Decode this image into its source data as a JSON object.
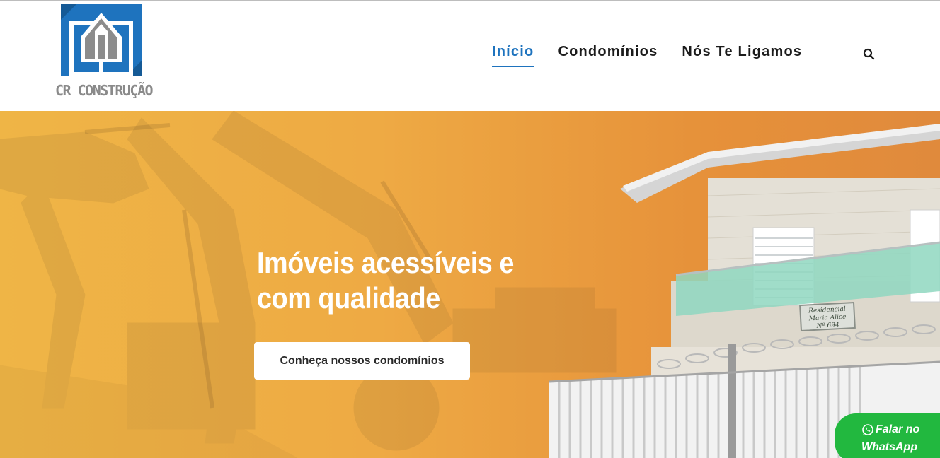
{
  "brand": {
    "logo_text": "CR CONSTRUÇÃO"
  },
  "colors": {
    "accent": "#1e73be",
    "hero_orange": "#eeaa44",
    "whatsapp_green": "#22b83f"
  },
  "nav": {
    "items": [
      {
        "label": "Início",
        "active": true
      },
      {
        "label": "Condomínios",
        "active": false
      },
      {
        "label": "Nós Te Ligamos",
        "active": false
      }
    ],
    "search_icon": "search-icon"
  },
  "hero": {
    "title_line1": "Imóveis acessíveis e",
    "title_line2": "com qualidade",
    "cta_label": "Conheça nossos condomínios",
    "sign_line1": "Residencial",
    "sign_line2": "Maria Alice",
    "sign_line3": "Nº 694"
  },
  "whatsapp": {
    "line1": "Falar no",
    "line2": "WhatsApp",
    "icon": "whatsapp-icon"
  }
}
